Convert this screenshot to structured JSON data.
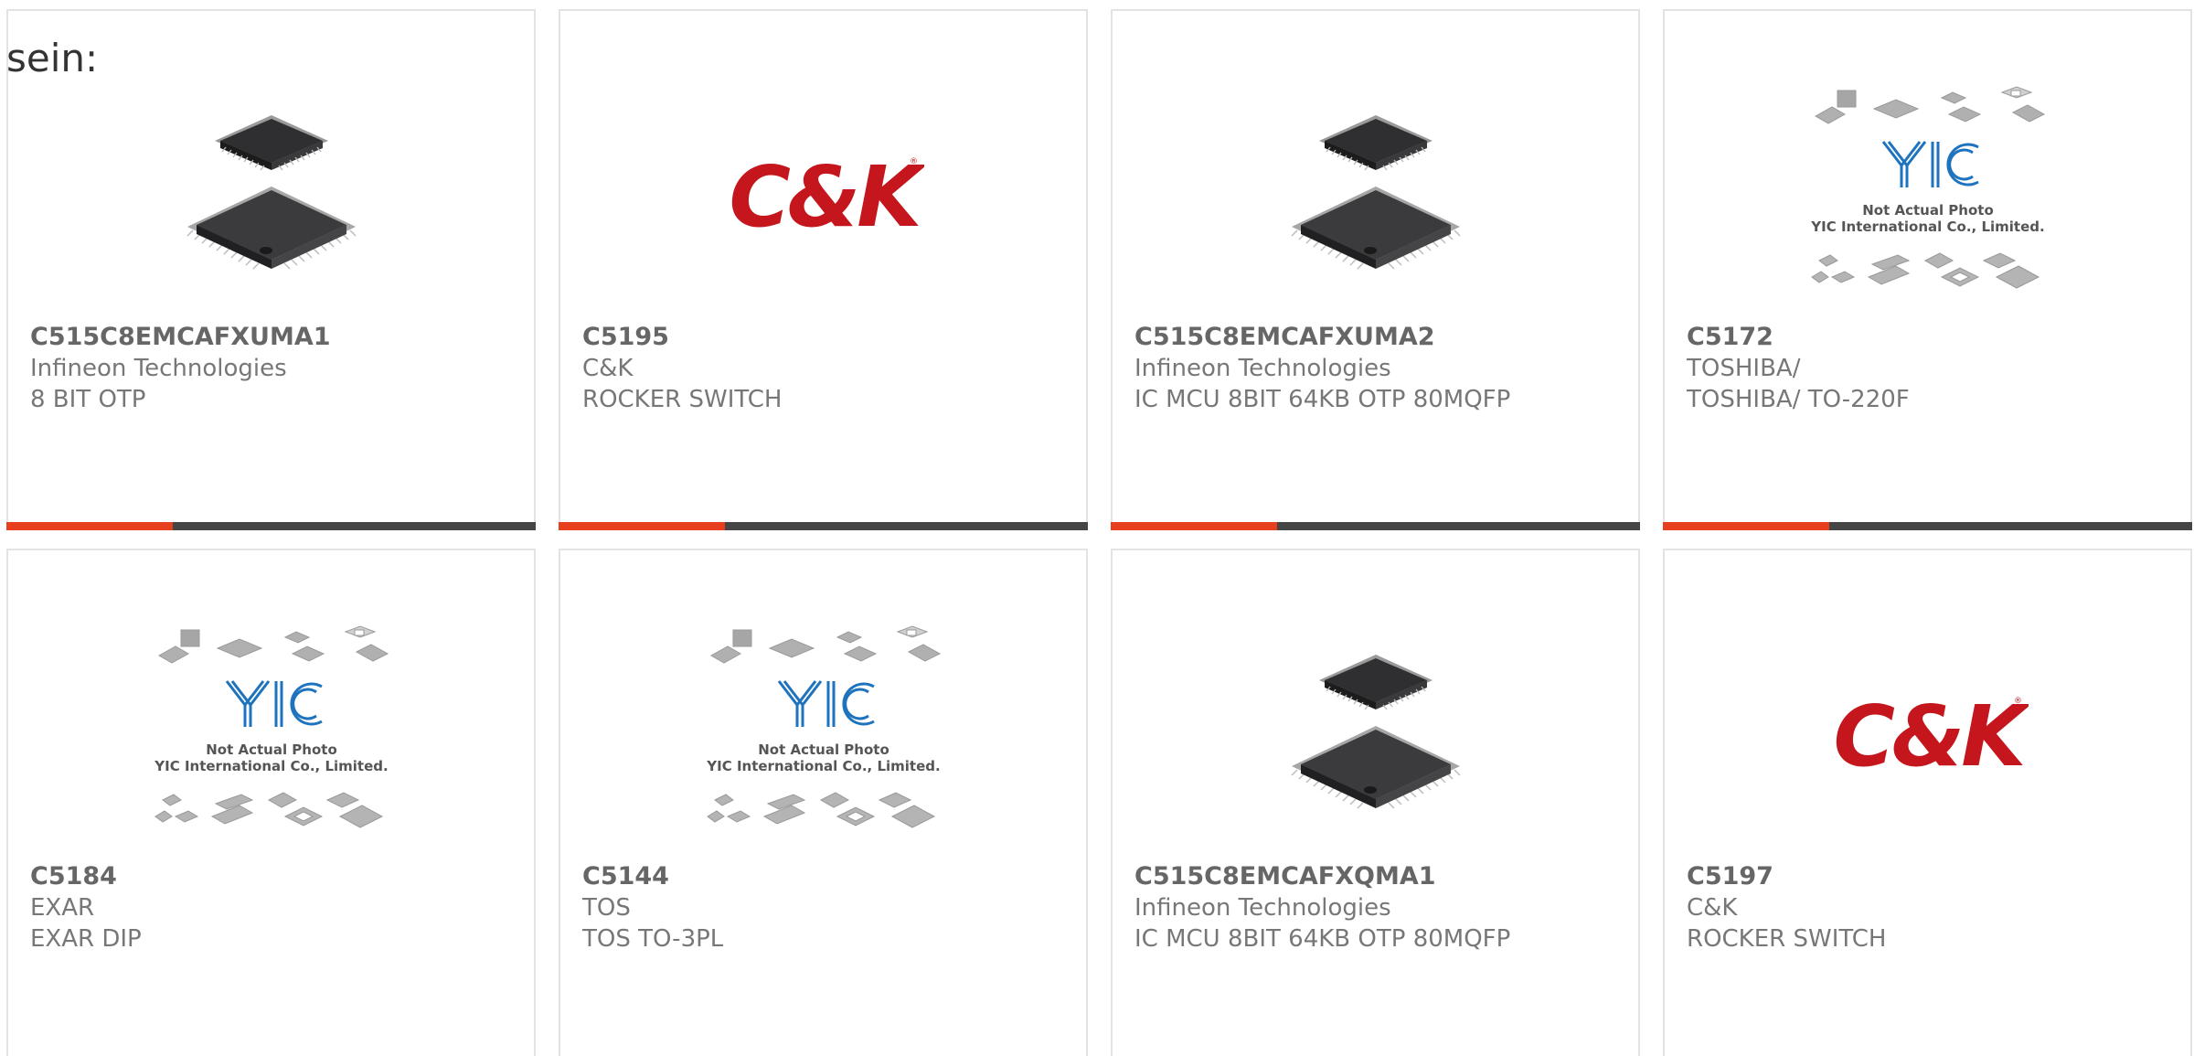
{
  "heading": "sein:",
  "colors": {
    "accent": "#e8401e",
    "bar": "#454545",
    "ck_red": "#c4161c",
    "yic_blue": "#1e73be"
  },
  "products": [
    {
      "part": "C515C8EMCAFXUMA1",
      "manufacturer": "Infineon Technologies",
      "description": "8 BIT OTP",
      "image": "qfp-chip-icon"
    },
    {
      "part": "C5195",
      "manufacturer": "C&K",
      "description": "ROCKER SWITCH",
      "image": "ck-logo"
    },
    {
      "part": "C515C8EMCAFXUMA2",
      "manufacturer": "Infineon Technologies",
      "description": "IC MCU 8BIT 64KB OTP 80MQFP",
      "image": "qfp-chip-icon"
    },
    {
      "part": "C5172",
      "manufacturer": "TOSHIBA/",
      "description": "TOSHIBA/ TO-220F",
      "image": "yic-placeholder"
    },
    {
      "part": "C5184",
      "manufacturer": "EXAR",
      "description": "EXAR DIP",
      "image": "yic-placeholder"
    },
    {
      "part": "C5144",
      "manufacturer": "TOS",
      "description": "TOS TO-3PL",
      "image": "yic-placeholder"
    },
    {
      "part": "C515C8EMCAFXQMA1",
      "manufacturer": "Infineon Technologies",
      "description": "IC MCU 8BIT 64KB OTP 80MQFP",
      "image": "qfp-chip-icon"
    },
    {
      "part": "C5197",
      "manufacturer": "C&K",
      "description": "ROCKER SWITCH",
      "image": "ck-logo"
    }
  ],
  "placeholder": {
    "logo_text": "YIC",
    "line1": "Not Actual Photo",
    "line2": "YIC International Co., Limited."
  },
  "ck_logo_text": "C&K"
}
